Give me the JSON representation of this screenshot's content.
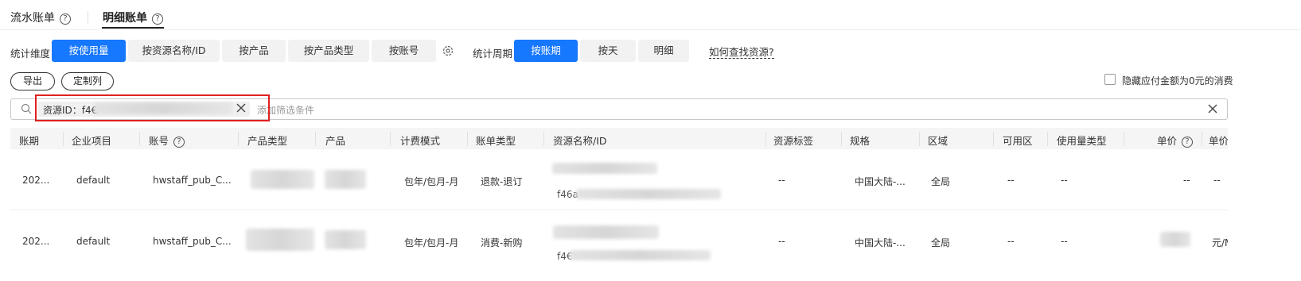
{
  "top_tabs": [
    {
      "label": "流水账单"
    },
    {
      "label": "明细账单"
    }
  ],
  "filter": {
    "dimension_label": "统计维度",
    "dimensions": [
      "按使用量",
      "按资源名称/ID",
      "按产品",
      "按产品类型",
      "按账号"
    ],
    "period_label": "统计周期",
    "periods": [
      "按账期",
      "按天",
      "明细"
    ],
    "help_link": "如何查找资源?"
  },
  "actions": {
    "export": "导出",
    "customize": "定制列",
    "hide_zero": "隐藏应付金额为0元的消费"
  },
  "search": {
    "tag_label": "资源ID：f4€",
    "placeholder": "添加筛选条件"
  },
  "table": {
    "headers": [
      "账期",
      "企业项目",
      "账号",
      "产品类型",
      "产品",
      "计费模式",
      "账单类型",
      "资源名称/ID",
      "资源标签",
      "规格",
      "区域",
      "可用区",
      "使用量类型",
      "单价",
      "单价"
    ],
    "rows": [
      {
        "period": "202...",
        "project": "default",
        "account": "hwstaff_pub_C...",
        "billing_mode": "包年/包月-月",
        "bill_type": "退款-退订",
        "resource_id": "f46a",
        "tag": "--",
        "spec": "中国大陆-...",
        "region": "全局",
        "az": "--",
        "usage_type": "--",
        "price": "--",
        "unit": "--"
      },
      {
        "period": "202...",
        "project": "default",
        "account": "hwstaff_pub_C...",
        "billing_mode": "包年/包月-月",
        "bill_type": "消费-新购",
        "resource_id": "f4€",
        "tag": "--",
        "spec": "中国大陆-...",
        "region": "全局",
        "az": "--",
        "usage_type": "--",
        "price": "",
        "unit": "元/​M"
      }
    ]
  },
  "colors": {
    "accent": "#1677ff",
    "highlight": "#e02020"
  }
}
